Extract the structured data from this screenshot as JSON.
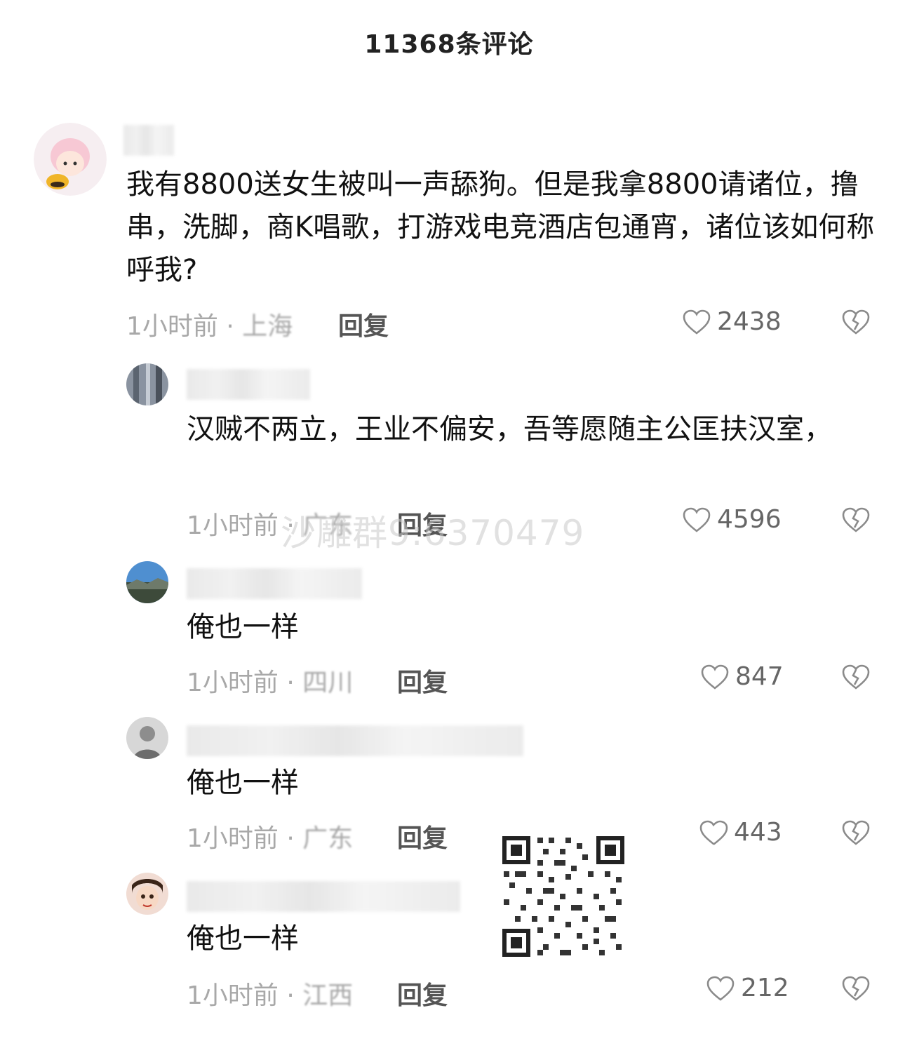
{
  "header": {
    "title": "11368条评论"
  },
  "watermark": "沙雕群9:6370479",
  "comments": [
    {
      "text": "我有8800送女生被叫一声舔狗。但是我拿8800请诸位，撸串，洗脚，商K唱歌，打游戏电竞酒店包通宵，诸位该如何称呼我?",
      "time": "1小时前",
      "location": "上海",
      "reply_label": "回复",
      "likes": "2438"
    },
    {
      "text": "汉贼不两立，王业不偏安，吾等愿随主公匡扶汉室，",
      "time": "1小时前",
      "location": "广东",
      "reply_label": "回复",
      "likes": "4596"
    },
    {
      "text": "俺也一样",
      "time": "1小时前",
      "location": "四川",
      "reply_label": "回复",
      "likes": "847"
    },
    {
      "text": "俺也一样",
      "time": "1小时前",
      "location": "广东",
      "reply_label": "回复",
      "likes": "443"
    },
    {
      "text": "俺也一样",
      "time": "1小时前",
      "location": "江西",
      "reply_label": "回复",
      "likes": "212"
    }
  ]
}
